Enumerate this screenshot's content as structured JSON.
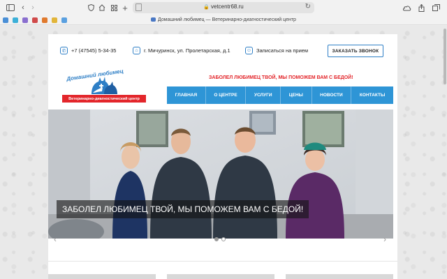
{
  "browser": {
    "url": "vetcentr68.ru",
    "tab_title": "Домашний любимец — Ветеринарно-диагностический центр",
    "icons": [
      "sidebar-icon",
      "back-icon",
      "forward-icon",
      "shield-icon",
      "home-icon",
      "grid-icon",
      "new-tab-icon",
      "page-icon",
      "lock-icon",
      "reload-icon",
      "cloud-icon",
      "share-icon",
      "tabs-icon"
    ]
  },
  "favorites": [
    "fav-1",
    "fav-2",
    "fav-3",
    "fav-4",
    "fav-5",
    "fav-6",
    "fav-7"
  ],
  "header": {
    "phone": "+7 (47545) 5-34-35",
    "address": "г. Мичуринск, ул. Пролетарская, д.1",
    "appointment": "Записаться на прием",
    "callback_button": "ЗАКАЗАТЬ ЗВОНОК"
  },
  "logo": {
    "arc_text": "Домашний любимец",
    "band_text": "Ветеринарно-диагностический центр"
  },
  "slogan": "ЗАБОЛЕЛ ЛЮБИМЕЦ ТВОЙ, МЫ ПОМОЖЕМ ВАМ С БЕДОЙ!",
  "nav": {
    "items": [
      "ГЛАВНАЯ",
      "О ЦЕНТРЕ",
      "УСЛУГИ",
      "ЦЕНЫ",
      "НОВОСТИ",
      "КОНТАКТЫ"
    ]
  },
  "slider": {
    "caption": "ЗАБОЛЕЛ ЛЮБИМЕЦ ТВОЙ, МЫ ПОМОЖЕМ ВАМ С БЕДОЙ!",
    "slide_count": 2,
    "active_slide": 1
  },
  "colors": {
    "accent_blue": "#2e95d6",
    "brand_red": "#e3262b",
    "scrub_navy": "#2f3945",
    "scrub_purple": "#5a2a66"
  }
}
